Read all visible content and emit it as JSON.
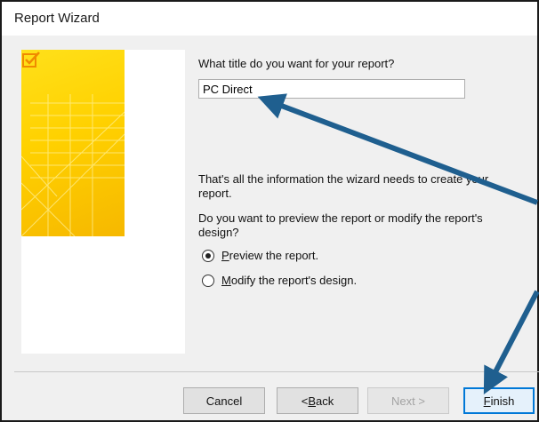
{
  "window": {
    "title": "Report Wizard"
  },
  "prompt": {
    "title_question": "What title do you want for your report?",
    "title_value": "PC Direct",
    "info_line1": "That's all the information the wizard needs to create your",
    "info_line2": "report.",
    "preview_question_line1": "Do you want to preview the report or modify the report's",
    "preview_question_line2": "design?"
  },
  "options": [
    {
      "mnemonic": "P",
      "rest": "review the report.",
      "checked": true
    },
    {
      "mnemonic": "M",
      "rest": "odify the report's design.",
      "checked": false
    }
  ],
  "buttons": {
    "cancel": "Cancel",
    "back_prefix": "< ",
    "back_mnemonic": "B",
    "back_rest": "ack",
    "next": "Next >",
    "finish_mnemonic": "F",
    "finish_rest": "inish"
  },
  "colors": {
    "annotation_arrow": "#1f5f8f",
    "wizard_art": "#ffd100"
  }
}
